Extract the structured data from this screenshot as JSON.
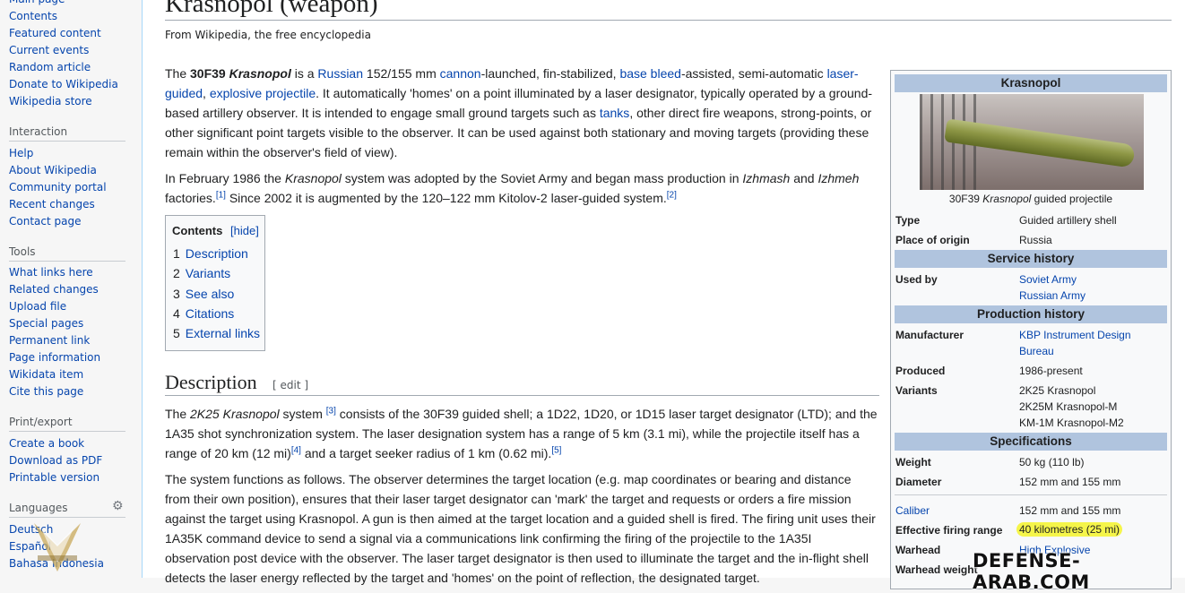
{
  "sidebar": {
    "nav": [
      "Main page",
      "Contents",
      "Featured content",
      "Current events",
      "Random article",
      "Donate to Wikipedia",
      "Wikipedia store"
    ],
    "interaction": {
      "heading": "Interaction",
      "items": [
        "Help",
        "About Wikipedia",
        "Community portal",
        "Recent changes",
        "Contact page"
      ]
    },
    "tools": {
      "heading": "Tools",
      "items": [
        "What links here",
        "Related changes",
        "Upload file",
        "Special pages",
        "Permanent link",
        "Page information",
        "Wikidata item",
        "Cite this page"
      ]
    },
    "print": {
      "heading": "Print/export",
      "items": [
        "Create a book",
        "Download as PDF",
        "Printable version"
      ]
    },
    "languages": {
      "heading": "Languages",
      "items": [
        "Deutsch",
        "Español",
        "Bahasa Indonesia"
      ]
    }
  },
  "article": {
    "title": "Krasnopol (weapon)",
    "tagline": "From Wikipedia, the free encyclopedia",
    "intro": {
      "t1": "The ",
      "b1": "30F39 ",
      "bi1": "Krasnopol",
      "t2": " is a ",
      "l1": "Russian",
      "t3": " 152/155 mm ",
      "l2": "cannon",
      "t4": "-launched, fin-stabilized, ",
      "l3": "base bleed",
      "t5": "-assisted, semi-automatic ",
      "l4": "laser-guided",
      "t6": ", ",
      "l5": "explosive projectile",
      "t7": ". It automatically 'homes' on a point illuminated by a laser designator, typically operated by a ground-based artillery observer. It is intended to engage small ground targets such as ",
      "l6": "tanks",
      "t8": ", other direct fire weapons, strong-points, or other significant point targets visible to the observer. It can be used against both stationary and moving targets (providing these remain within the observer's field of view)."
    },
    "history": {
      "t1": "In February 1986 the ",
      "i1": "Krasnopol",
      "t2": " system was adopted by the Soviet Army and began mass production in ",
      "i2": "Izhmash",
      "t3": " and ",
      "i3": "Izhmeh",
      "t4": " factories.",
      "r1": "[1]",
      "t5": " Since 2002 it is augmented by the 120–122 mm Kitolov-2 laser-guided system.",
      "r2": "[2]"
    },
    "toc": {
      "title": "Contents",
      "hide": "[hide]",
      "items": [
        {
          "num": "1",
          "label": "Description"
        },
        {
          "num": "2",
          "label": "Variants"
        },
        {
          "num": "3",
          "label": "See also"
        },
        {
          "num": "4",
          "label": "Citations"
        },
        {
          "num": "5",
          "label": "External links"
        }
      ]
    },
    "description": {
      "heading": "Description",
      "edit": "[ edit ]",
      "p1": {
        "t1": "The ",
        "i1": "2K25 Krasnopol",
        "t2": " system ",
        "r1": "[3]",
        "t3": " consists of the 30F39 guided shell; a 1D22, 1D20, or 1D15 laser target designator (LTD); and the 1A35 shot synchronization system. The laser designation system has a range of 5 km (3.1 mi), while the projectile itself has a range of 20 km (12 mi)",
        "r2": "[4]",
        "t4": " and a target seeker radius of 1 km (0.62 mi).",
        "r3": "[5]"
      },
      "p2": "The system functions as follows. The observer determines the target location (e.g. map coordinates or bearing and distance from their own position), ensures that their laser target designator can 'mark' the target and requests or orders a fire mission against the target using Krasnopol. A gun is then aimed at the target location and a guided shell is fired. The firing unit uses their 1A35K command device to send a signal via a communications link confirming the firing of the projectile to the 1A35I observation post device with the observer. The laser target designator is then used to illuminate the target and the in-flight shell detects the laser energy reflected by the target and 'homes' on the point of reflection, the designated target."
    }
  },
  "infobox": {
    "title": "Krasnopol",
    "caption_pre": "30F39 ",
    "caption_italic": "Krasnopol",
    "caption_post": " guided projectile",
    "type_label": "Type",
    "type_value": "Guided artillery shell",
    "origin_label": "Place of origin",
    "origin_value": "Russia",
    "service_heading": "Service history",
    "used_by_label": "Used by",
    "used_by_1": "Soviet Army",
    "used_by_2": "Russian Army",
    "production_heading": "Production history",
    "manufacturer_label": "Manufacturer",
    "manufacturer_1": "KBP Instrument Design",
    "manufacturer_2": "Bureau",
    "produced_label": "Produced",
    "produced_value": "1986-present",
    "variants_label": "Variants",
    "variant_1": "2K25 Krasnopol",
    "variant_2": "2K25M Krasnopol-M",
    "variant_3": "KM-1M Krasnopol-M2",
    "spec_heading": "Specifications",
    "weight_label": "Weight",
    "weight_value": "50 kg (110 lb)",
    "diameter_label": "Diameter",
    "diameter_value": "152 mm and 155 mm",
    "caliber_label": "Caliber",
    "caliber_value": "152 mm and 155 mm",
    "range_label": "Effective firing range",
    "range_value": "40 kilometres (25 mi)",
    "warhead_label": "Warhead",
    "warhead_value": "High Explosive",
    "warhead_weight_label": "Warhead weight"
  },
  "watermark": {
    "site": "DEFENSE-ARAB.COM"
  },
  "colors": {
    "link": "#0645ad",
    "infobox_header": "#b0c4de",
    "highlight": "#f5f54a"
  }
}
